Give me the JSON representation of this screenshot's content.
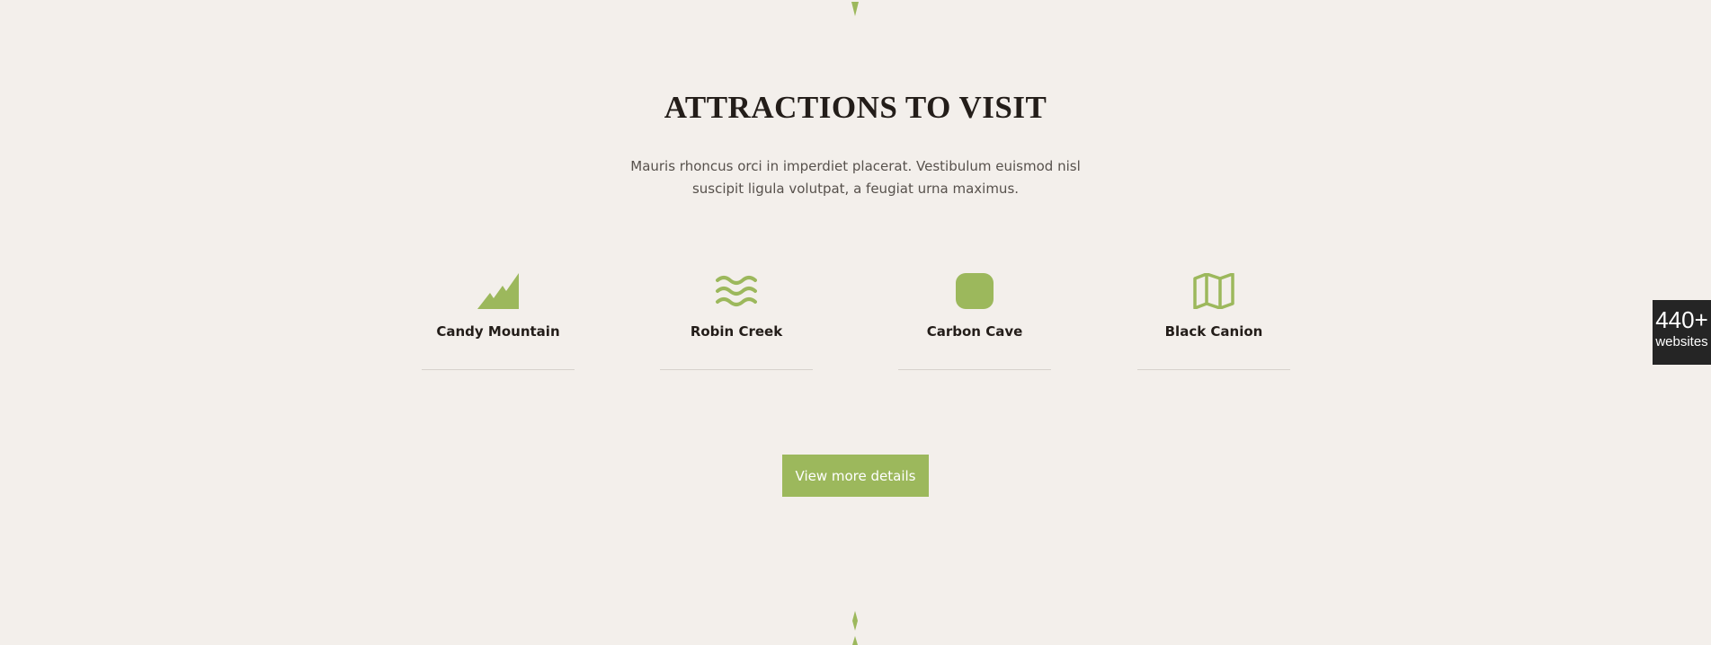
{
  "colors": {
    "background": "#f3efeb",
    "accent": "#9cb85c",
    "heading": "#231d19",
    "body_text": "#57514c",
    "divider": "#d6d1cc",
    "badge_bg": "#252525"
  },
  "section": {
    "title": "ATTRACTIONS TO VISIT",
    "description": "Mauris rhoncus orci in imperdiet placerat. Vestibulum euismod nisl suscipit ligula volutpat, a feugiat urna maximus."
  },
  "attractions": [
    {
      "label": "Candy Mountain",
      "icon": "mountain-icon"
    },
    {
      "label": "Robin Creek",
      "icon": "waves-icon"
    },
    {
      "label": "Carbon Cave",
      "icon": "rounded-square-icon"
    },
    {
      "label": "Black Canion",
      "icon": "map-icon"
    }
  ],
  "cta": {
    "label": "View more details"
  },
  "side_badge": {
    "count": "440+",
    "unit": "websites"
  }
}
